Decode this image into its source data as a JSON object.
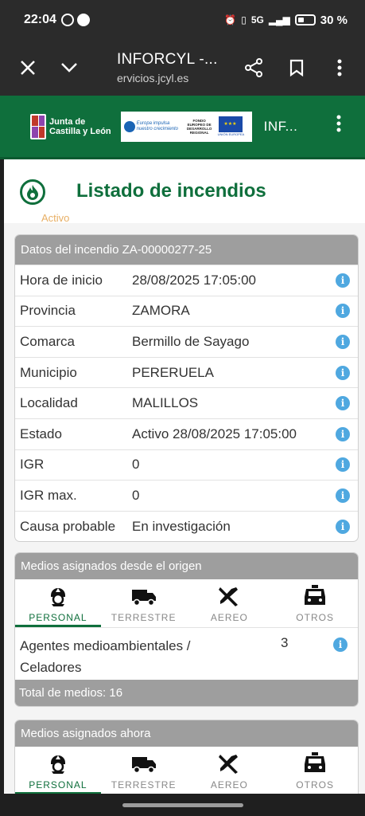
{
  "status_bar": {
    "time": "22:04",
    "battery": "30 %",
    "network": "5G"
  },
  "browser": {
    "title": "INFORCYL -...",
    "url": "ervicios.jcyl.es"
  },
  "site_header": {
    "logo_line1": "Junta de",
    "logo_line2": "Castilla y León",
    "eu_slogan_line1": "Europa impulsa",
    "eu_slogan_line2": "nuestro crecimiento",
    "eu_fondo": "FONDO EUROPEO DE DESARROLLO REGIONAL",
    "eu_union": "UNIÓN EUROPEA",
    "app_abbrev": "INF..."
  },
  "page": {
    "title": "Listado de incendios",
    "ghost_text": "Activo"
  },
  "datos_card": {
    "header": "Datos del incendio ZA-00000277-25",
    "rows": [
      {
        "label": "Hora de inicio",
        "value": "28/08/2025 17:05:00"
      },
      {
        "label": "Provincia",
        "value": "ZAMORA"
      },
      {
        "label": "Comarca",
        "value": "Bermillo de Sayago"
      },
      {
        "label": "Municipio",
        "value": "PERERUELA"
      },
      {
        "label": "Localidad",
        "value": "MALILLOS"
      },
      {
        "label": "Estado",
        "value": "Activo 28/08/2025 17:05:00"
      },
      {
        "label": "IGR",
        "value": "0"
      },
      {
        "label": "IGR max.",
        "value": "0"
      },
      {
        "label": "Causa probable",
        "value": "En investigación"
      }
    ]
  },
  "origen_card": {
    "header": "Medios asignados desde el origen",
    "tabs": [
      "PERSONAL",
      "TERRESTRE",
      "AEREO",
      "OTROS"
    ],
    "active_tab": "PERSONAL",
    "medio_line1": "Agentes medioambientales /",
    "medio_line2": "Celadores",
    "medio_count": "3",
    "total": "Total de medios: 16"
  },
  "ahora_card": {
    "header": "Medios asignados ahora",
    "tabs": [
      "PERSONAL",
      "TERRESTRE",
      "AEREO",
      "OTROS"
    ],
    "active_tab": "PERSONAL"
  },
  "colors": {
    "brand_green": "#0f6f3c",
    "card_header_gray": "#9e9e9e",
    "info_blue": "#4fa8e0"
  }
}
